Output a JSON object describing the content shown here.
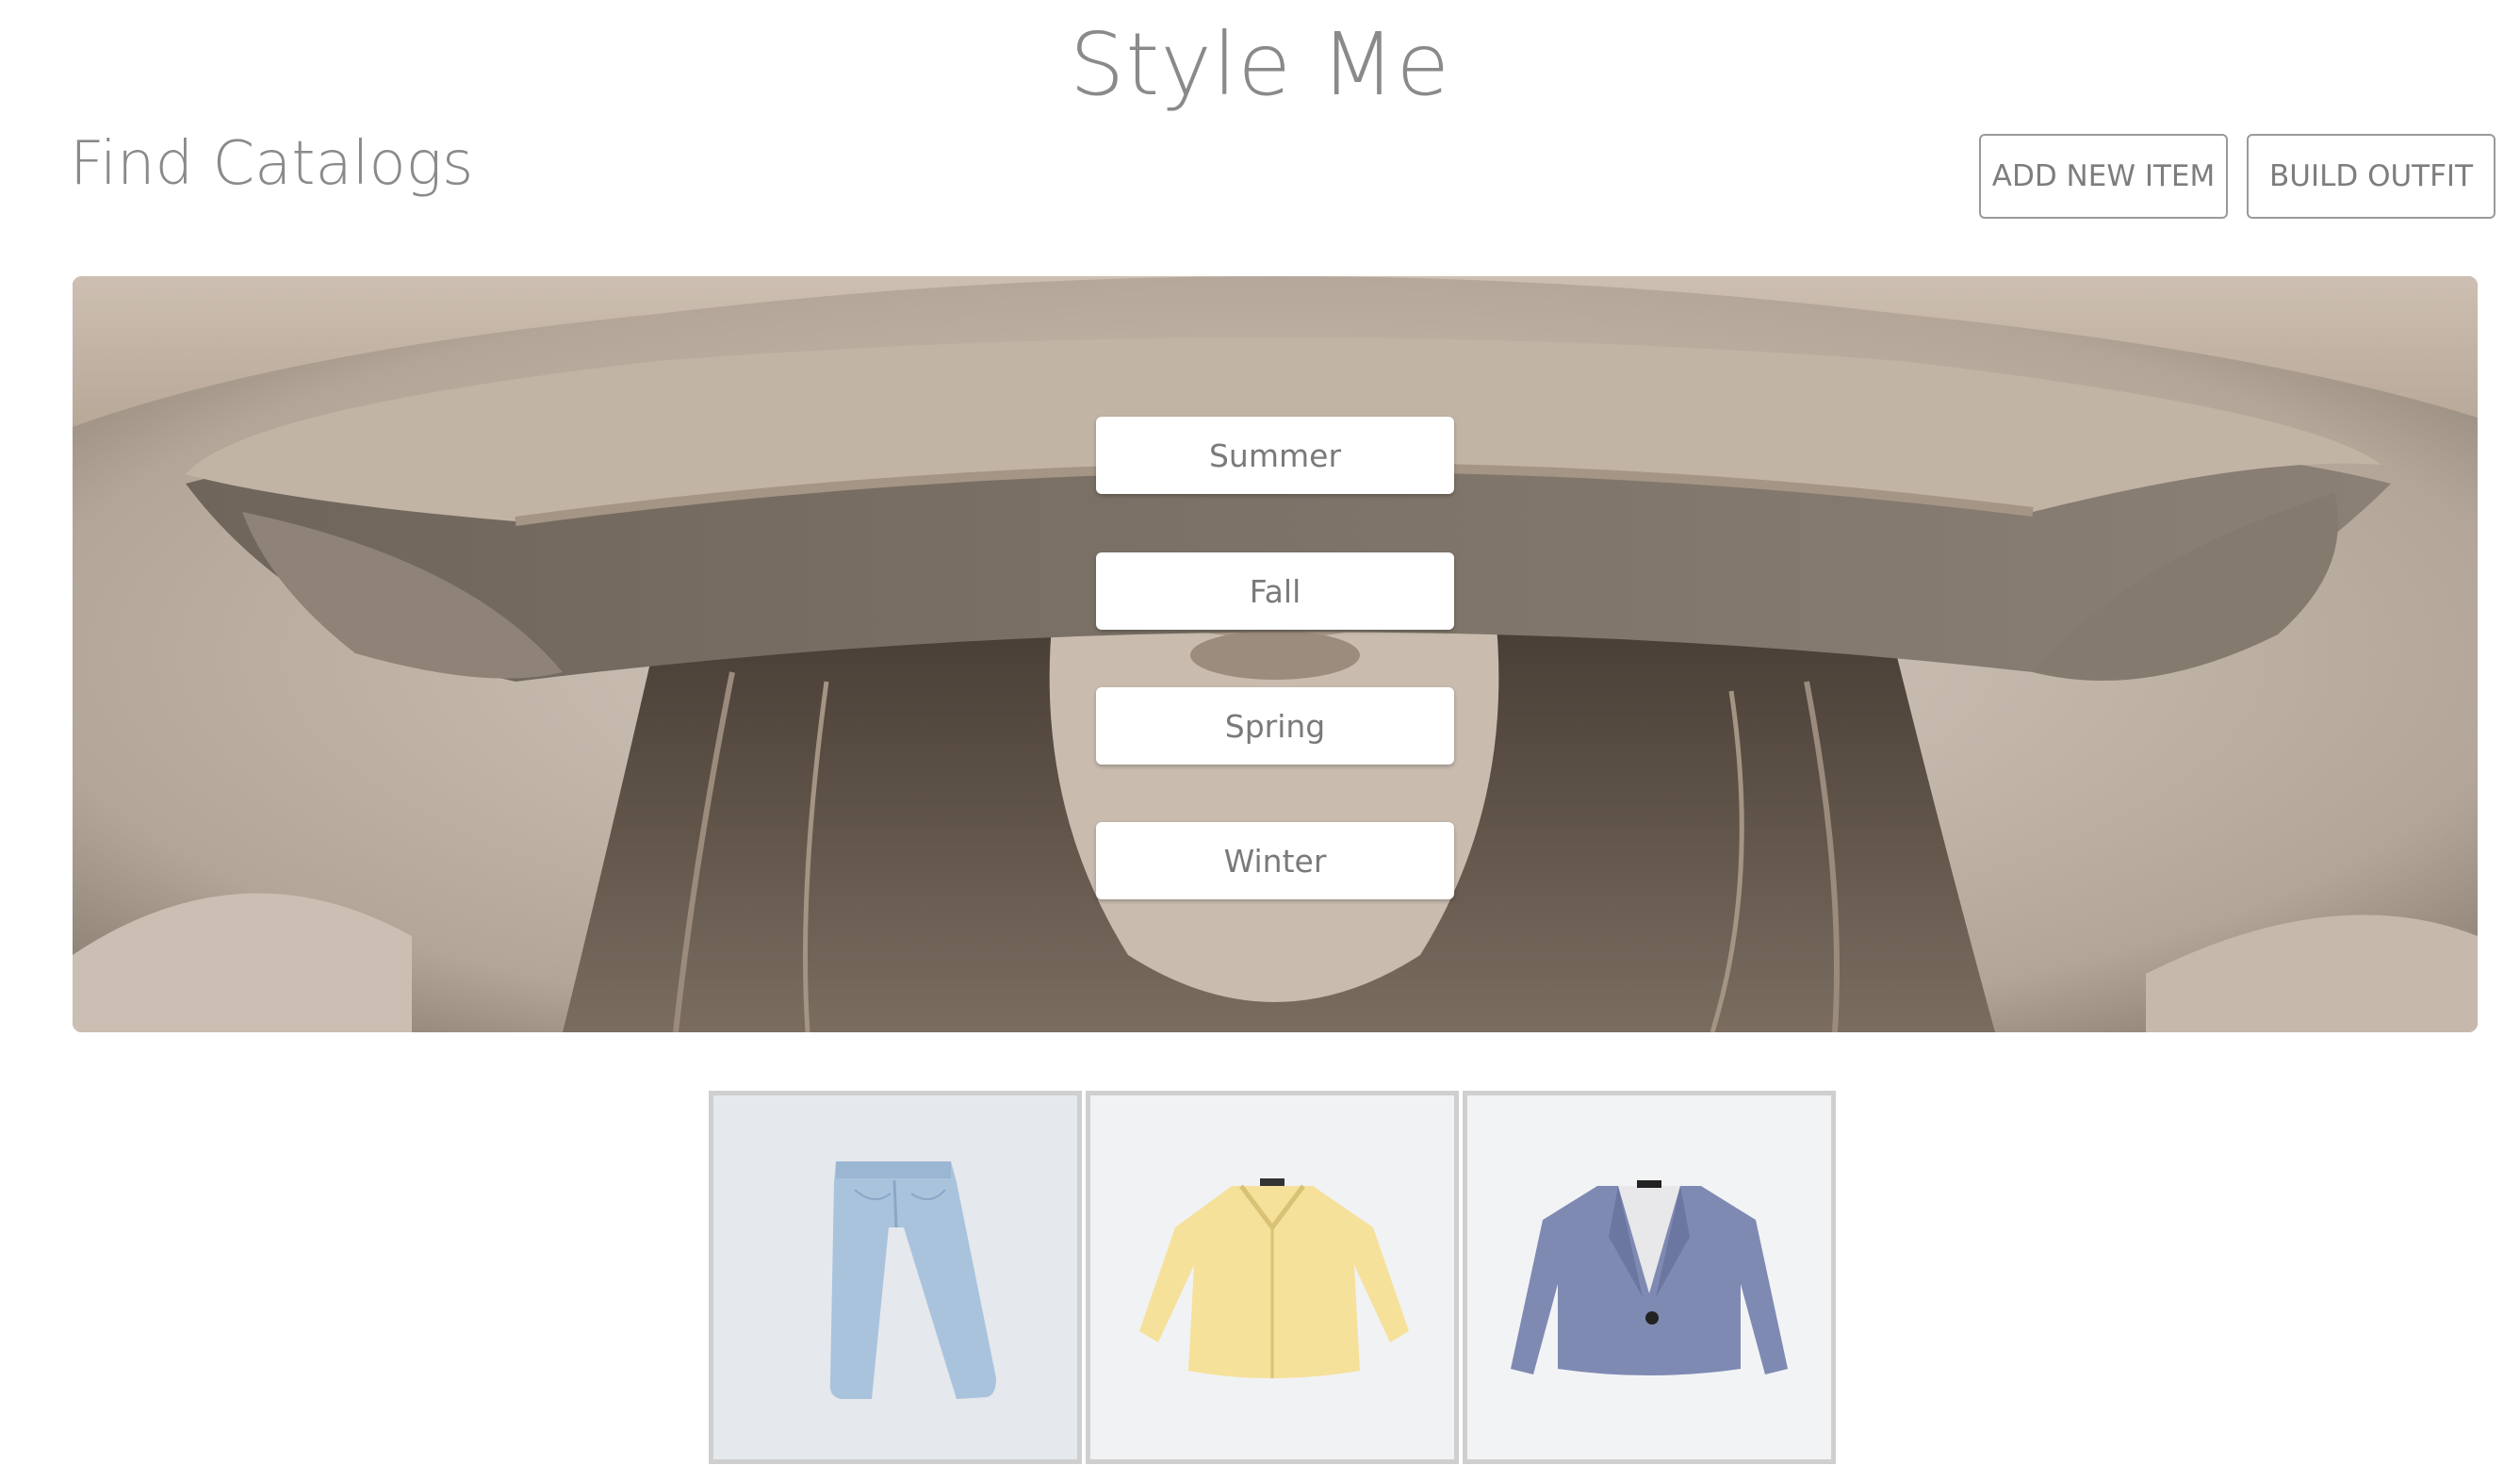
{
  "site": {
    "title": "Style Me"
  },
  "header": {
    "section_title": "Find Catalogs",
    "add_new_item_label": "ADD NEW ITEM",
    "build_outfit_label": "BUILD OUTFIT"
  },
  "hero": {
    "image": "woman-in-wide-brim-hat-photo",
    "seasons": [
      {
        "label": "Summer"
      },
      {
        "label": "Fall"
      },
      {
        "label": "Spring"
      },
      {
        "label": "Winter"
      }
    ]
  },
  "catalog_items": [
    {
      "image": "light-blue-jeans"
    },
    {
      "image": "yellow-button-shirt"
    },
    {
      "image": "blue-blazer"
    }
  ],
  "colors": {
    "title_text": "#8a8a8a",
    "button_border": "#9a9a9a",
    "thumb_border": "#cfcfcf"
  }
}
